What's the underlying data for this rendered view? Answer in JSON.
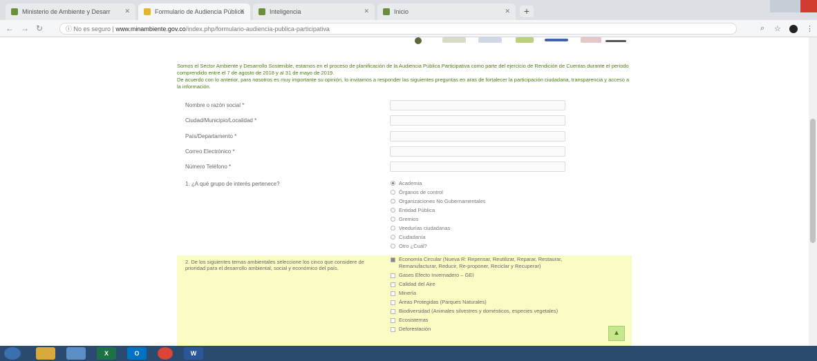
{
  "browser": {
    "tabs": [
      {
        "title": "Ministerio de Ambiente y Desarr",
        "fav_color": "#6a8f3c"
      },
      {
        "title": "Formulario de Audiencia Pública",
        "fav_color": "#e3b52b"
      },
      {
        "title": "Inteligencia",
        "fav_color": "#6a8f3c"
      },
      {
        "title": "Inicio",
        "fav_color": "#6a8f3c"
      }
    ],
    "address": {
      "security": "No es seguro",
      "domain": "www.minambiente.gov.co",
      "path": "/index.php/formulario-audiencia-publica-participativa"
    }
  },
  "form": {
    "intro1": "Somos el Sector Ambiente y Desarrollo Sostenible, estamos en el proceso de planificación de la Audiencia Pública Participativa como parte del ejercicio de Rendición de Cuentas durante el periodo comprendido entre el 7 de agosto de 2018 y al 31 de mayo de 2019.",
    "intro2": "De acuerdo con lo anterior, para nosotros es muy importante su opinión, lo invitamos a responder las siguientes preguntas en aras de fortalecer la participación ciudadana, transparencia y acceso a la información.",
    "fields": [
      {
        "label": "Nombre o razón social *"
      },
      {
        "label": "Ciudad/Municipio/Localidad *"
      },
      {
        "label": "País/Departamento *"
      },
      {
        "label": "Correo Electrónico *"
      },
      {
        "label": "Número Teléfono *"
      }
    ],
    "q1": {
      "label": "1. ¿A qué grupo de interés pertenece?",
      "options": [
        "Academia",
        "Órganos de control",
        "Organizaciones No Gubernamentales",
        "Entidad Pública",
        "Gremios",
        "Veedurías ciudadanas",
        "Ciudadanía",
        "Otro ¿Cuál?"
      ],
      "selected": 0
    },
    "q2": {
      "label": "2. De los siguientes temas ambientales seleccione los cinco que considere de prioridad para el desarrollo ambiental, social y económico del país.",
      "options": [
        "Economía Circular (Nueva R: Repensar, Reutilizar, Reparar, Restaurar, Remanufacturar, Reducir, Re-proponer, Reciclar y Recuperar)",
        "Gases Efecto Invernadero – GEI",
        "Calidad del Aire",
        "Minería",
        "Áreas Protegidas (Parques Naturales)",
        "Biodiversidad (Animales silvestres y domésticos, especies vegetales)",
        "Ecosistemas",
        "Deforestación"
      ],
      "checked": [
        0
      ]
    },
    "totop_glyph": "▲"
  },
  "taskbar": {
    "apps": [
      {
        "glyph": "",
        "color": "#3a6fb0"
      },
      {
        "glyph": "",
        "color": "#d9a93b"
      },
      {
        "glyph": "",
        "color": "#5b8fc6"
      },
      {
        "glyph": "X",
        "color": "#1e7145"
      },
      {
        "glyph": "O",
        "color": "#0072c6"
      },
      {
        "glyph": "",
        "color": "#db4437"
      },
      {
        "glyph": "W",
        "color": "#2b579a"
      }
    ]
  }
}
